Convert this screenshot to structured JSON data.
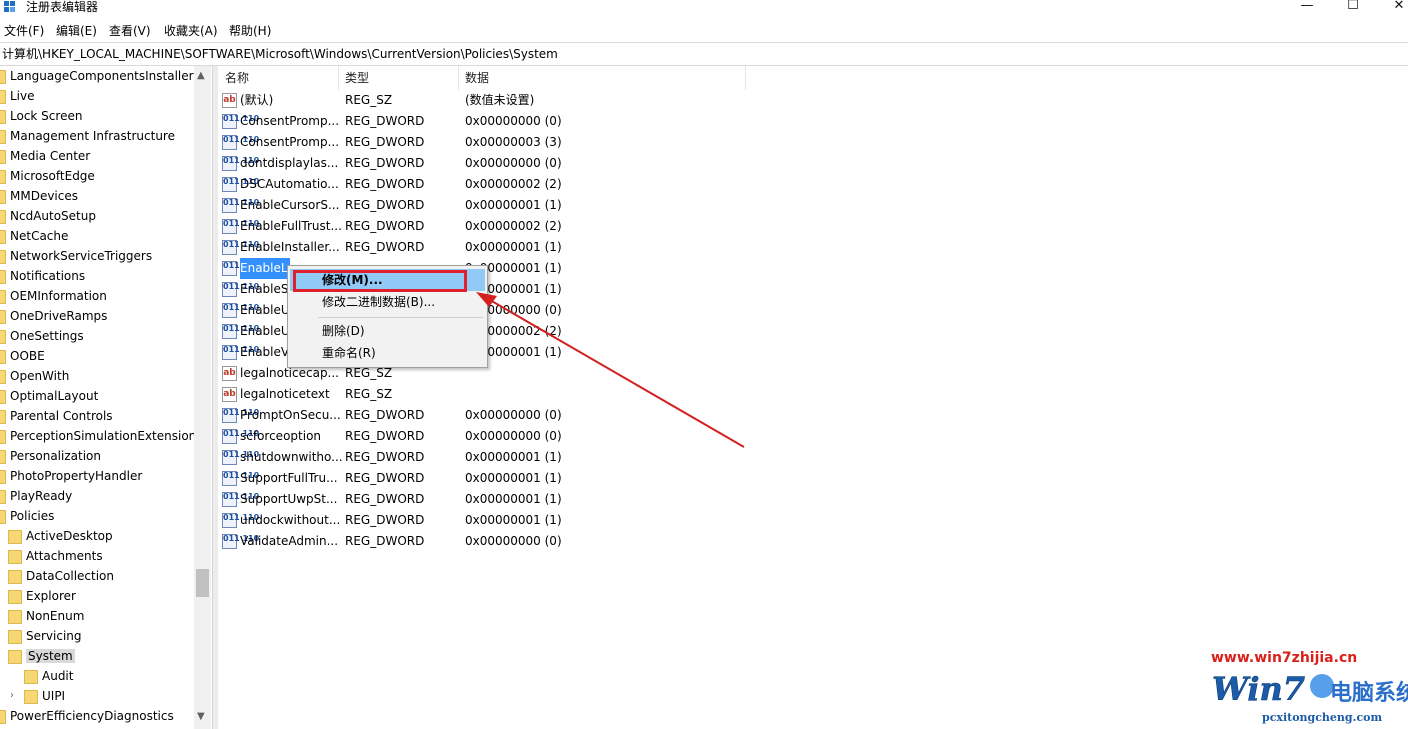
{
  "window": {
    "title": "注册表编辑器",
    "minimize": "—",
    "maximize": "☐",
    "close": "✕"
  },
  "menu": [
    "文件(F)",
    "编辑(E)",
    "查看(V)",
    "收藏夹(A)",
    "帮助(H)"
  ],
  "address": "计算机\\HKEY_LOCAL_MACHINE\\SOFTWARE\\Microsoft\\Windows\\CurrentVersion\\Policies\\System",
  "tree": {
    "items": [
      "LanguageComponentsInstaller",
      "Live",
      "Lock Screen",
      "Management Infrastructure",
      "Media Center",
      "MicrosoftEdge",
      "MMDevices",
      "NcdAutoSetup",
      "NetCache",
      "NetworkServiceTriggers",
      "Notifications",
      "OEMInformation",
      "OneDriveRamps",
      "OneSettings",
      "OOBE",
      "OpenWith",
      "OptimalLayout",
      "Parental Controls",
      "PerceptionSimulationExtensions",
      "Personalization",
      "PhotoPropertyHandler",
      "PlayReady",
      "Policies"
    ],
    "policies_children": [
      "ActiveDesktop",
      "Attachments",
      "DataCollection",
      "Explorer",
      "NonEnum",
      "Servicing",
      "System"
    ],
    "system_children": [
      "Audit",
      "UIPI"
    ],
    "last_item": "PowerEfficiencyDiagnostics",
    "selected": "System"
  },
  "columns": {
    "name": "名称",
    "type": "类型",
    "data": "数据"
  },
  "rows": [
    {
      "icon": "string-value-icon",
      "name": "(默认)",
      "type": "REG_SZ",
      "data": "(数值未设置)"
    },
    {
      "icon": "dword-value-icon",
      "name": "ConsentPromp...",
      "type": "REG_DWORD",
      "data": "0x00000000 (0)"
    },
    {
      "icon": "dword-value-icon",
      "name": "ConsentPromp...",
      "type": "REG_DWORD",
      "data": "0x00000003 (3)"
    },
    {
      "icon": "dword-value-icon",
      "name": "dontdisplaylas...",
      "type": "REG_DWORD",
      "data": "0x00000000 (0)"
    },
    {
      "icon": "dword-value-icon",
      "name": "DSCAutomatio...",
      "type": "REG_DWORD",
      "data": "0x00000002 (2)"
    },
    {
      "icon": "dword-value-icon",
      "name": "EnableCursorS...",
      "type": "REG_DWORD",
      "data": "0x00000001 (1)"
    },
    {
      "icon": "dword-value-icon",
      "name": "EnableFullTrust...",
      "type": "REG_DWORD",
      "data": "0x00000002 (2)"
    },
    {
      "icon": "dword-value-icon",
      "name": "EnableInstaller...",
      "type": "REG_DWORD",
      "data": "0x00000001 (1)"
    },
    {
      "icon": "dword-value-icon",
      "name": "EnableL",
      "type": "",
      "data": "0x00000001 (1)"
    },
    {
      "icon": "dword-value-icon",
      "name": "EnableS",
      "type": "",
      "data": "0x00000001 (1)"
    },
    {
      "icon": "dword-value-icon",
      "name": "EnableU",
      "type": "",
      "data": "0x00000000 (0)"
    },
    {
      "icon": "dword-value-icon",
      "name": "EnableU",
      "type": "",
      "data": "0x00000002 (2)"
    },
    {
      "icon": "dword-value-icon",
      "name": "EnableV",
      "type": "",
      "data": "0x00000001 (1)"
    },
    {
      "icon": "string-value-icon",
      "name": "legalnoticecap...",
      "type": "REG_SZ",
      "data": ""
    },
    {
      "icon": "string-value-icon",
      "name": "legalnoticetext",
      "type": "REG_SZ",
      "data": ""
    },
    {
      "icon": "dword-value-icon",
      "name": "PromptOnSecu...",
      "type": "REG_DWORD",
      "data": "0x00000000 (0)"
    },
    {
      "icon": "dword-value-icon",
      "name": "scforceoption",
      "type": "REG_DWORD",
      "data": "0x00000000 (0)"
    },
    {
      "icon": "dword-value-icon",
      "name": "shutdownwitho...",
      "type": "REG_DWORD",
      "data": "0x00000001 (1)"
    },
    {
      "icon": "dword-value-icon",
      "name": "SupportFullTru...",
      "type": "REG_DWORD",
      "data": "0x00000001 (1)"
    },
    {
      "icon": "dword-value-icon",
      "name": "SupportUwpSt...",
      "type": "REG_DWORD",
      "data": "0x00000001 (1)"
    },
    {
      "icon": "dword-value-icon",
      "name": "undockwithout...",
      "type": "REG_DWORD",
      "data": "0x00000001 (1)"
    },
    {
      "icon": "dword-value-icon",
      "name": "ValidateAdmin...",
      "type": "REG_DWORD",
      "data": "0x00000000 (0)"
    }
  ],
  "selected_row": 8,
  "context_menu": {
    "modify": "修改(M)...",
    "modify_binary": "修改二进制数据(B)...",
    "delete": "删除(D)",
    "rename": "重命名(R)"
  },
  "annotation": {
    "highlight_color": "#e0202a",
    "arrow_color": "#d32020"
  },
  "watermark": {
    "url": "www.win7zhijia.cn",
    "logo_text": "Win7",
    "logo_cn": "电脑系统城",
    "sub": "pcxitongcheng.com"
  }
}
